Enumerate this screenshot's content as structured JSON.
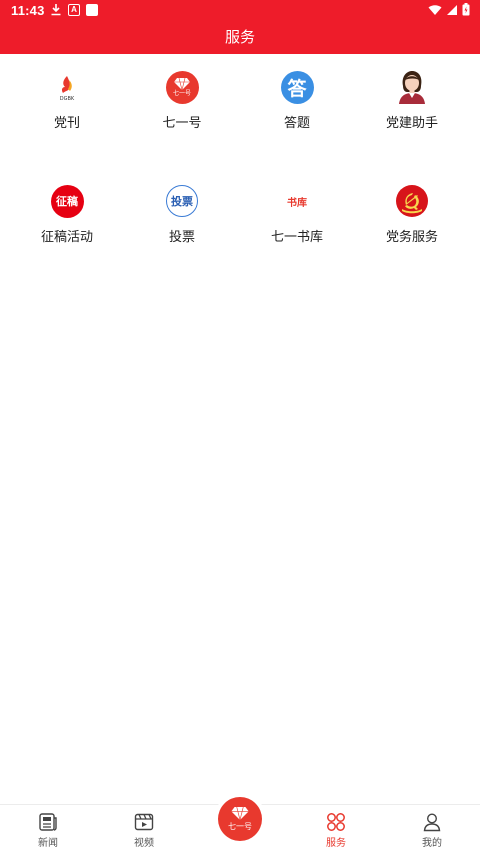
{
  "status_bar": {
    "time": "11:43",
    "icons": [
      "download-icon",
      "a-icon",
      "square-icon",
      "wifi-icon",
      "signal-icon",
      "battery-icon"
    ]
  },
  "header": {
    "title": "服务"
  },
  "services": [
    {
      "label": "党刊",
      "icon": "dangkan-logo-icon"
    },
    {
      "label": "七一号",
      "icon": "qiyihao-diamond-icon",
      "icon_text": "七一号"
    },
    {
      "label": "答题",
      "icon": "dati-icon",
      "icon_text": "答"
    },
    {
      "label": "党建助手",
      "icon": "assistant-avatar-icon"
    },
    {
      "label": "征稿活动",
      "icon": "zhenggao-icon",
      "icon_text": "征稿"
    },
    {
      "label": "投票",
      "icon": "toupiao-icon",
      "icon_text": "投票"
    },
    {
      "label": "七一书库",
      "icon": "shuku-icon",
      "icon_text": "书库"
    },
    {
      "label": "党务服务",
      "icon": "party-emblem-icon"
    }
  ],
  "bottom_nav": {
    "items": [
      {
        "label": "新闻",
        "icon": "news-icon",
        "active": false
      },
      {
        "label": "视频",
        "icon": "video-icon",
        "active": false
      },
      {
        "label": "服务",
        "icon": "service-grid-icon",
        "active": true
      },
      {
        "label": "我的",
        "icon": "profile-icon",
        "active": false
      }
    ],
    "center": {
      "label": "七一号",
      "icon": "qiyihao-diamond-icon"
    }
  },
  "colors": {
    "brand_red": "#ee1c2a",
    "icon_red": "#e8392e",
    "answer_blue": "#3a8fe3"
  }
}
